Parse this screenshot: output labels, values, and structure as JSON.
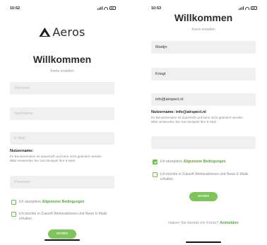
{
  "left_screen": {
    "status_time": "10:52",
    "brand": "Aeros",
    "title": "Willkommen",
    "subtitle": "Konto erstellen",
    "fields": {
      "first_name_placeholder": "Vorname",
      "last_name_placeholder": "Nachname",
      "email_placeholder": "E-Mail",
      "password_placeholder": "Passwort"
    },
    "username_note_title": "Nutzername:",
    "username_note_body": "Ihr Benutzername ist dauerhaft und kann nicht geändert werden. Bitte verwenden Sie zum Beispiel Ihre E-Mail.",
    "terms_prefix": "Ich akzeptiere",
    "terms_link": "Allgemeine Bedingungen",
    "terms_checked": false,
    "newsletter_label": "Ich möchte in Zukunft Werbeaktionen und News E-Mails erhalten",
    "newsletter_checked": false,
    "send_label": "senden"
  },
  "right_screen": {
    "status_time": "10:53",
    "title": "Willkommen",
    "subtitle": "Konto erstellen",
    "fields": {
      "first_name_value": "Martijn",
      "last_name_value": "Kriegt",
      "email_value": "info@airspect.nl"
    },
    "username_note_title": "Nutzername: info@airspect.nl",
    "username_note_body": "Ihr Benutzername ist dauerhaft und kann nicht geändert werden. Bitte verwenden Sie zum Beispiel Ihre E-Mail.",
    "terms_prefix": "Ich akzeptiere",
    "terms_link": "Allgemeine Bedingungen",
    "terms_checked": true,
    "newsletter_label": "Ich möchte in Zukunft Werbeaktionen und News E-Mails erhalten",
    "newsletter_checked": false,
    "send_label": "senden",
    "login_prompt": "Haben Sie bereits ein Konto?",
    "login_link": "Anmelden"
  },
  "colors": {
    "accent_green": "#7dc55b",
    "field_background": "#f0f0f0"
  },
  "icons": [
    "signal-icon",
    "wifi-icon",
    "battery-icon",
    "aeros-logo-icon",
    "checkbox-icon"
  ]
}
